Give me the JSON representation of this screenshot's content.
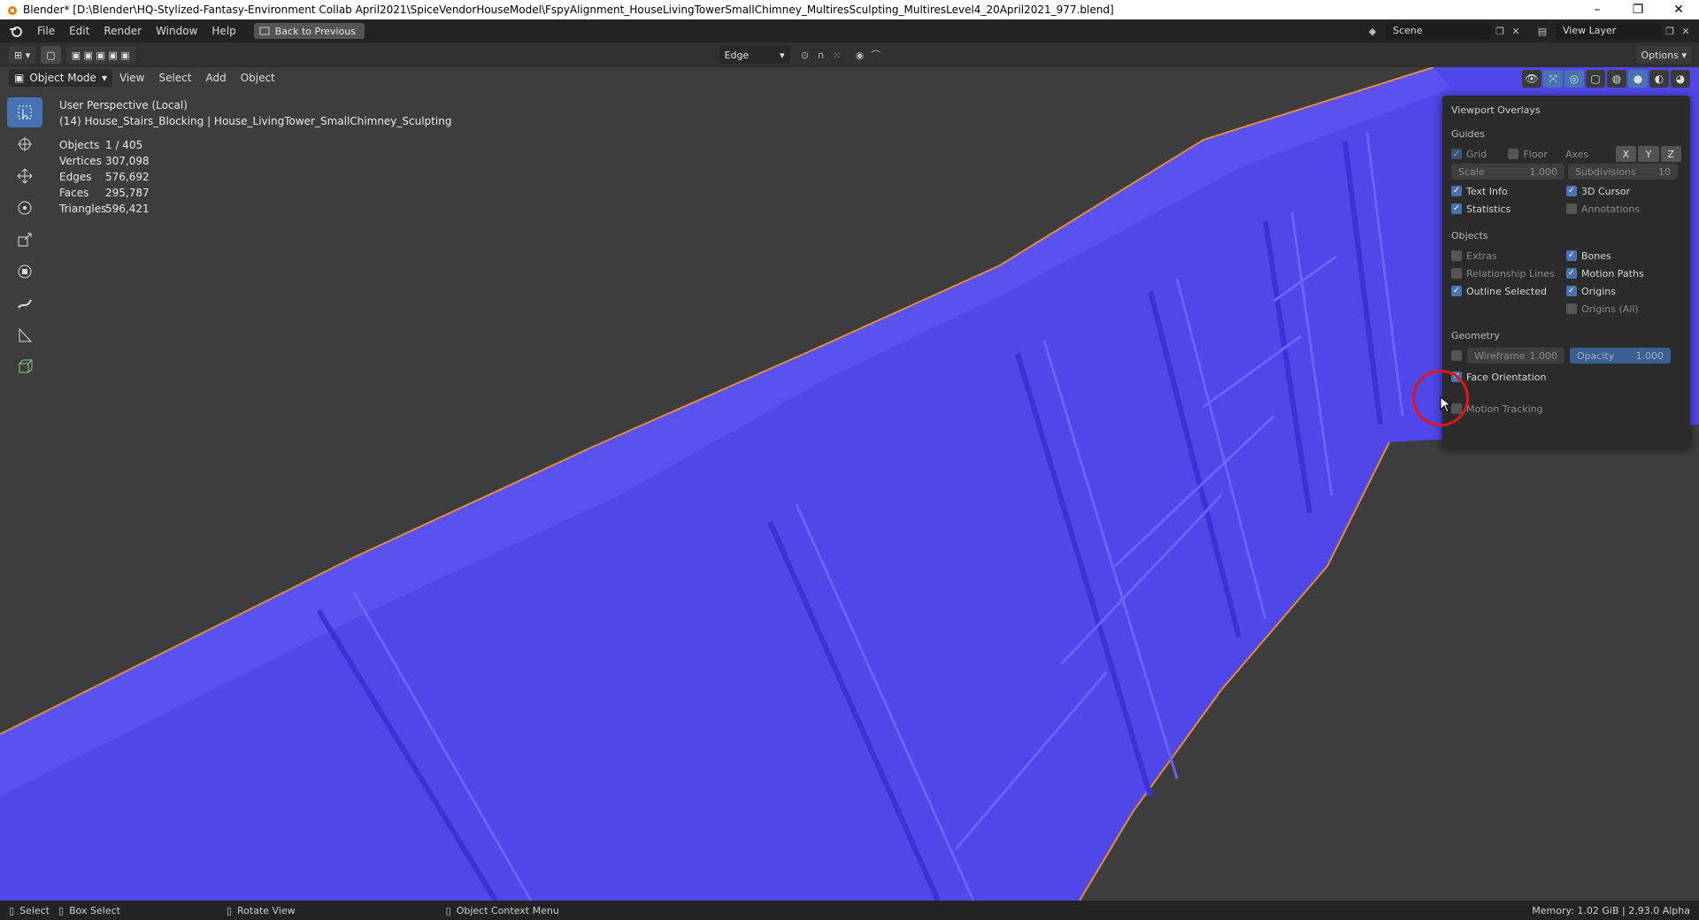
{
  "window": {
    "title": "Blender* [D:\\Blender\\HQ-Stylized-Fantasy-Environment  Collab April2021\\SpiceVendorHouseModel\\FspyAlignment_HouseLivingTowerSmallChimney_MultiresSculpting_MultiresLevel4_20April2021_977.blend]",
    "minimize": "–",
    "maximize": "❐",
    "close": "✕"
  },
  "menubar": {
    "items": [
      "File",
      "Edit",
      "Render",
      "Window",
      "Help"
    ],
    "back_label": "Back to Previous",
    "scene": "Scene",
    "view_layer": "View Layer"
  },
  "toolheader": {
    "snap_select": "Edge",
    "options": "Options"
  },
  "viewport_header": {
    "mode": "Object Mode",
    "items": [
      "View",
      "Select",
      "Add",
      "Object"
    ]
  },
  "overlay_text": {
    "perspective": "User Perspective (Local)",
    "object": "(14) House_Stairs_Blocking | House_LivingTower_SmallChimney_Sculpting"
  },
  "stats": [
    {
      "label": "Objects",
      "value": "1 / 405"
    },
    {
      "label": "Vertices",
      "value": "307,098"
    },
    {
      "label": "Edges",
      "value": "576,692"
    },
    {
      "label": "Faces",
      "value": "295,787"
    },
    {
      "label": "Triangles",
      "value": "596,421"
    }
  ],
  "overlays_panel": {
    "title": "Viewport Overlays",
    "guides_heading": "Guides",
    "grid": "Grid",
    "floor": "Floor",
    "axes": "Axes",
    "axis_x": "X",
    "axis_y": "Y",
    "axis_z": "Z",
    "scale_label": "Scale",
    "scale_value": "1.000",
    "subdiv_label": "Subdivisions",
    "subdiv_value": "10",
    "text_info": "Text Info",
    "cursor_3d": "3D Cursor",
    "statistics": "Statistics",
    "annotations": "Annotations",
    "objects_heading": "Objects",
    "extras": "Extras",
    "bones": "Bones",
    "relationship_lines": "Relationship Lines",
    "motion_paths": "Motion Paths",
    "outline_selected": "Outline Selected",
    "origins": "Origins",
    "origins_all": "Origins (All)",
    "geometry_heading": "Geometry",
    "wireframe_label": "Wireframe",
    "wireframe_value": "1.000",
    "opacity_label": "Opacity",
    "opacity_value": "1.000",
    "face_orientation": "Face Orientation",
    "motion_tracking": "Motion Tracking"
  },
  "statusbar": {
    "select": "Select",
    "box_select": "Box Select",
    "rotate_view": "Rotate View",
    "context_menu": "Object Context Menu",
    "memory": "Memory: 1.02 GiB | 2.93.0 Alpha"
  },
  "colors": {
    "mesh_blue": "#4a40e6",
    "outline": "#e08a3c",
    "accent": "#4772b3",
    "click_ring": "#e0151b"
  }
}
